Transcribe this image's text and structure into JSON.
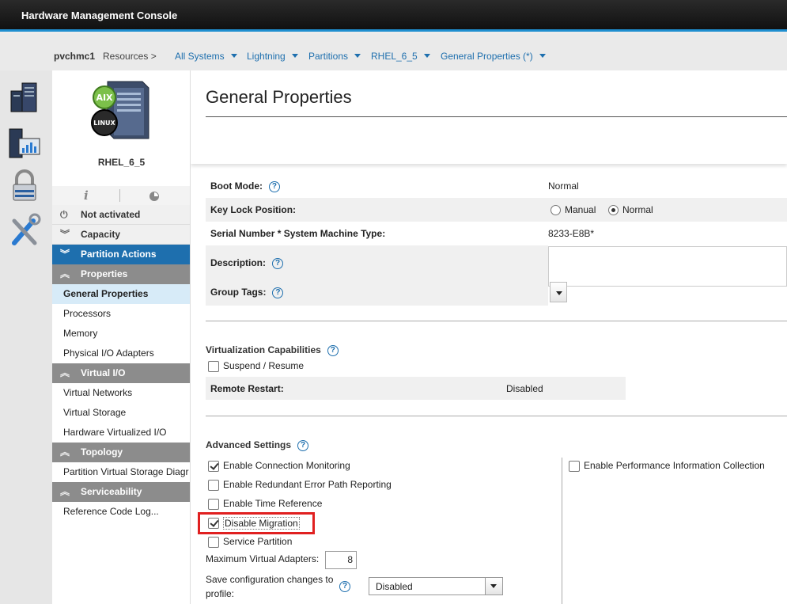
{
  "app": {
    "title": "Hardware Management Console"
  },
  "breadcrumb": {
    "host": "pvchmc1",
    "resources": "Resources >",
    "items": [
      "All Systems",
      "Lightning",
      "Partitions",
      "RHEL_6_5",
      "General Properties (*)"
    ]
  },
  "partition": {
    "name": "RHEL_6_5",
    "badges": [
      "AIX",
      "LINUX"
    ]
  },
  "nav": {
    "status": "Not activated",
    "capacity": "Capacity",
    "partition_actions": "Partition Actions",
    "properties": "Properties",
    "properties_items": [
      "General Properties",
      "Processors",
      "Memory",
      "Physical I/O Adapters"
    ],
    "virtual_io": "Virtual I/O",
    "virtual_io_items": [
      "Virtual Networks",
      "Virtual Storage",
      "Hardware Virtualized I/O"
    ],
    "topology": "Topology",
    "topology_items": [
      "Partition Virtual Storage Diagr"
    ],
    "serviceability": "Serviceability",
    "serviceability_items": [
      "Reference Code Log..."
    ]
  },
  "page": {
    "title": "General Properties"
  },
  "props": {
    "boot_mode_label": "Boot Mode:",
    "boot_mode_value": "Normal",
    "key_lock_label": "Key Lock Position:",
    "key_lock_manual": "Manual",
    "key_lock_normal": "Normal",
    "key_lock_selected": "Normal",
    "serial_label": "Serial Number * System Machine Type:",
    "serial_value": "8233-E8B*",
    "description_label": "Description:",
    "description_value": "",
    "group_tags_label": "Group Tags:",
    "help_glyph": "?"
  },
  "virtualization": {
    "heading": "Virtualization Capabilities",
    "suspend_label": "Suspend / Resume",
    "suspend_checked": false,
    "remote_restart_label": "Remote Restart:",
    "remote_restart_value": "Disabled"
  },
  "advanced": {
    "heading": "Advanced Settings",
    "options": [
      {
        "label": "Enable Connection Monitoring",
        "checked": true
      },
      {
        "label": "Enable Redundant Error Path Reporting",
        "checked": false
      },
      {
        "label": "Enable Time Reference",
        "checked": false
      },
      {
        "label": "Disable Migration",
        "checked": true
      },
      {
        "label": "Service Partition",
        "checked": false
      }
    ],
    "perf_label": "Enable Performance Information Collection",
    "perf_checked": false,
    "max_adapters_label": "Maximum Virtual Adapters:",
    "max_adapters_value": "8",
    "save_config_label_1": "Save configuration changes to",
    "save_config_label_2": "profile:",
    "save_config_value": "Disabled"
  },
  "colors": {
    "accent": "#1e6fae",
    "highlight": "#e02020",
    "titlebar": "#1a1a1a"
  },
  "icons": [
    "servers-icon",
    "monitor-chart-icon",
    "lock-icon",
    "tools-icon",
    "server-os-icon",
    "info-icon",
    "pie-chart-icon",
    "help-icon",
    "chevron-icon",
    "dropdown-caret-icon"
  ]
}
